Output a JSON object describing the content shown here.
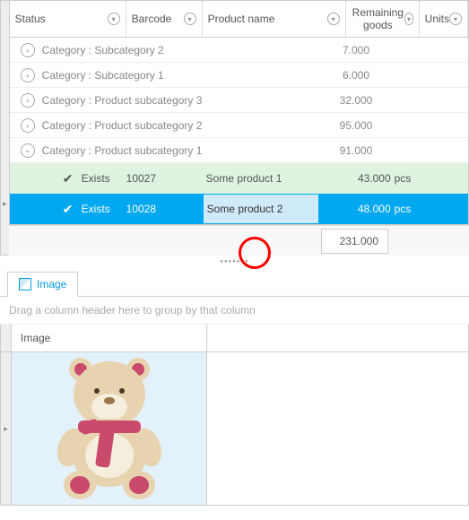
{
  "columns": {
    "status": "Status",
    "barcode": "Barcode",
    "product": "Product name",
    "remain": "Remaining goods",
    "units": "Units"
  },
  "groups": [
    {
      "label": "Category : Subcategory 2",
      "total": "7.000",
      "expanded": false
    },
    {
      "label": "Category : Subcategory 1",
      "total": "6.000",
      "expanded": false
    },
    {
      "label": "Category : Product subcategory 3",
      "total": "32.000",
      "expanded": false
    },
    {
      "label": "Category : Product subcategory 2",
      "total": "95.000",
      "expanded": false
    },
    {
      "label": "Category : Product subcategory 1",
      "total": "91.000",
      "expanded": true
    }
  ],
  "rows": [
    {
      "status": "Exists",
      "barcode": "10027",
      "product": "Some product 1",
      "remain": "43.000",
      "units": "pcs",
      "selected": false
    },
    {
      "status": "Exists",
      "barcode": "10028",
      "product": "Some product 2",
      "remain": "48.000",
      "units": "pcs",
      "selected": true
    }
  ],
  "grand_total": "231.000",
  "detail": {
    "tab": "Image",
    "group_hint": "Drag a column header here to group by that column",
    "image_col": "Image"
  }
}
